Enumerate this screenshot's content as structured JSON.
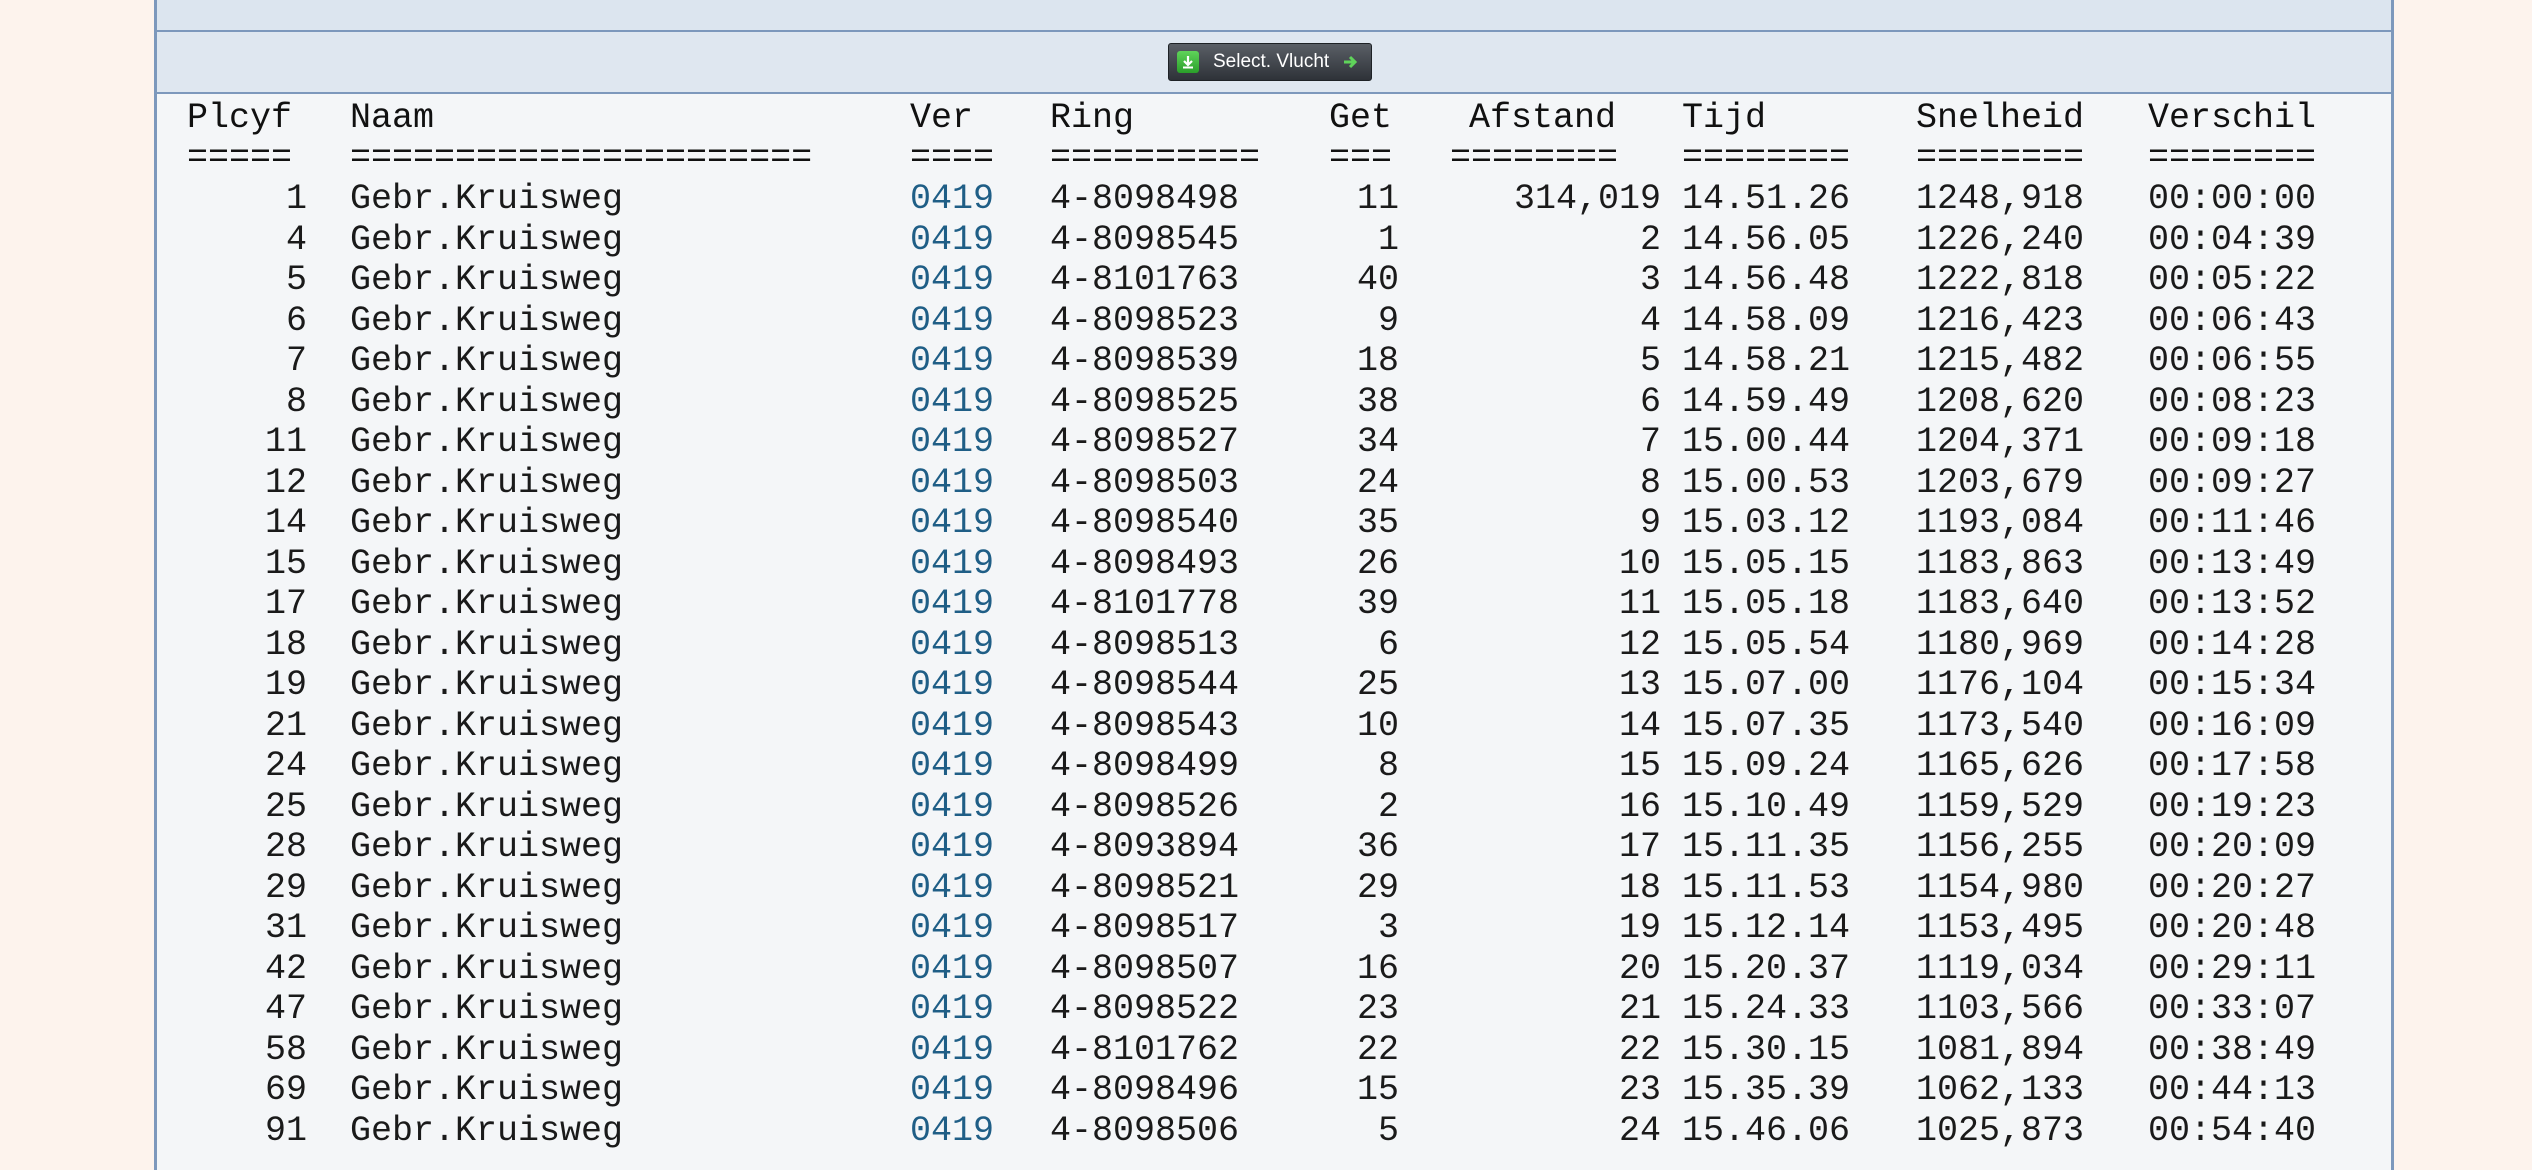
{
  "toolbar": {
    "select_label": "Select. Vlucht"
  },
  "columns": {
    "plcyf": "Plcyf",
    "naam": "Naam",
    "ver": "Ver",
    "ring": "Ring",
    "get": "Get",
    "afstand": "Afstand",
    "tijd": "Tijd",
    "snelheid": "Snelheid",
    "verschil": "Verschil"
  },
  "separators": {
    "plcyf": "=====",
    "naam": "======================",
    "ver": "====",
    "ring": "==========",
    "get": "===",
    "afstand": "========",
    "tijd": "========",
    "snelheid": "========",
    "verschil": "========"
  },
  "rows": [
    {
      "plcyf": "1",
      "naam": "Gebr.Kruisweg",
      "ver": "0419",
      "ring": "4-8098498",
      "get": "11",
      "afstand": "314,019",
      "tijd": "14.51.26",
      "snelheid": "1248,918",
      "verschil": "00:00:00"
    },
    {
      "plcyf": "4",
      "naam": "Gebr.Kruisweg",
      "ver": "0419",
      "ring": "4-8098545",
      "get": "1",
      "afstand": "2",
      "tijd": "14.56.05",
      "snelheid": "1226,240",
      "verschil": "00:04:39"
    },
    {
      "plcyf": "5",
      "naam": "Gebr.Kruisweg",
      "ver": "0419",
      "ring": "4-8101763",
      "get": "40",
      "afstand": "3",
      "tijd": "14.56.48",
      "snelheid": "1222,818",
      "verschil": "00:05:22"
    },
    {
      "plcyf": "6",
      "naam": "Gebr.Kruisweg",
      "ver": "0419",
      "ring": "4-8098523",
      "get": "9",
      "afstand": "4",
      "tijd": "14.58.09",
      "snelheid": "1216,423",
      "verschil": "00:06:43"
    },
    {
      "plcyf": "7",
      "naam": "Gebr.Kruisweg",
      "ver": "0419",
      "ring": "4-8098539",
      "get": "18",
      "afstand": "5",
      "tijd": "14.58.21",
      "snelheid": "1215,482",
      "verschil": "00:06:55"
    },
    {
      "plcyf": "8",
      "naam": "Gebr.Kruisweg",
      "ver": "0419",
      "ring": "4-8098525",
      "get": "38",
      "afstand": "6",
      "tijd": "14.59.49",
      "snelheid": "1208,620",
      "verschil": "00:08:23"
    },
    {
      "plcyf": "11",
      "naam": "Gebr.Kruisweg",
      "ver": "0419",
      "ring": "4-8098527",
      "get": "34",
      "afstand": "7",
      "tijd": "15.00.44",
      "snelheid": "1204,371",
      "verschil": "00:09:18"
    },
    {
      "plcyf": "12",
      "naam": "Gebr.Kruisweg",
      "ver": "0419",
      "ring": "4-8098503",
      "get": "24",
      "afstand": "8",
      "tijd": "15.00.53",
      "snelheid": "1203,679",
      "verschil": "00:09:27"
    },
    {
      "plcyf": "14",
      "naam": "Gebr.Kruisweg",
      "ver": "0419",
      "ring": "4-8098540",
      "get": "35",
      "afstand": "9",
      "tijd": "15.03.12",
      "snelheid": "1193,084",
      "verschil": "00:11:46"
    },
    {
      "plcyf": "15",
      "naam": "Gebr.Kruisweg",
      "ver": "0419",
      "ring": "4-8098493",
      "get": "26",
      "afstand": "10",
      "tijd": "15.05.15",
      "snelheid": "1183,863",
      "verschil": "00:13:49"
    },
    {
      "plcyf": "17",
      "naam": "Gebr.Kruisweg",
      "ver": "0419",
      "ring": "4-8101778",
      "get": "39",
      "afstand": "11",
      "tijd": "15.05.18",
      "snelheid": "1183,640",
      "verschil": "00:13:52"
    },
    {
      "plcyf": "18",
      "naam": "Gebr.Kruisweg",
      "ver": "0419",
      "ring": "4-8098513",
      "get": "6",
      "afstand": "12",
      "tijd": "15.05.54",
      "snelheid": "1180,969",
      "verschil": "00:14:28"
    },
    {
      "plcyf": "19",
      "naam": "Gebr.Kruisweg",
      "ver": "0419",
      "ring": "4-8098544",
      "get": "25",
      "afstand": "13",
      "tijd": "15.07.00",
      "snelheid": "1176,104",
      "verschil": "00:15:34"
    },
    {
      "plcyf": "21",
      "naam": "Gebr.Kruisweg",
      "ver": "0419",
      "ring": "4-8098543",
      "get": "10",
      "afstand": "14",
      "tijd": "15.07.35",
      "snelheid": "1173,540",
      "verschil": "00:16:09"
    },
    {
      "plcyf": "24",
      "naam": "Gebr.Kruisweg",
      "ver": "0419",
      "ring": "4-8098499",
      "get": "8",
      "afstand": "15",
      "tijd": "15.09.24",
      "snelheid": "1165,626",
      "verschil": "00:17:58"
    },
    {
      "plcyf": "25",
      "naam": "Gebr.Kruisweg",
      "ver": "0419",
      "ring": "4-8098526",
      "get": "2",
      "afstand": "16",
      "tijd": "15.10.49",
      "snelheid": "1159,529",
      "verschil": "00:19:23"
    },
    {
      "plcyf": "28",
      "naam": "Gebr.Kruisweg",
      "ver": "0419",
      "ring": "4-8093894",
      "get": "36",
      "afstand": "17",
      "tijd": "15.11.35",
      "snelheid": "1156,255",
      "verschil": "00:20:09"
    },
    {
      "plcyf": "29",
      "naam": "Gebr.Kruisweg",
      "ver": "0419",
      "ring": "4-8098521",
      "get": "29",
      "afstand": "18",
      "tijd": "15.11.53",
      "snelheid": "1154,980",
      "verschil": "00:20:27"
    },
    {
      "plcyf": "31",
      "naam": "Gebr.Kruisweg",
      "ver": "0419",
      "ring": "4-8098517",
      "get": "3",
      "afstand": "19",
      "tijd": "15.12.14",
      "snelheid": "1153,495",
      "verschil": "00:20:48"
    },
    {
      "plcyf": "42",
      "naam": "Gebr.Kruisweg",
      "ver": "0419",
      "ring": "4-8098507",
      "get": "16",
      "afstand": "20",
      "tijd": "15.20.37",
      "snelheid": "1119,034",
      "verschil": "00:29:11"
    },
    {
      "plcyf": "47",
      "naam": "Gebr.Kruisweg",
      "ver": "0419",
      "ring": "4-8098522",
      "get": "23",
      "afstand": "21",
      "tijd": "15.24.33",
      "snelheid": "1103,566",
      "verschil": "00:33:07"
    },
    {
      "plcyf": "58",
      "naam": "Gebr.Kruisweg",
      "ver": "0419",
      "ring": "4-8101762",
      "get": "22",
      "afstand": "22",
      "tijd": "15.30.15",
      "snelheid": "1081,894",
      "verschil": "00:38:49"
    },
    {
      "plcyf": "69",
      "naam": "Gebr.Kruisweg",
      "ver": "0419",
      "ring": "4-8098496",
      "get": "15",
      "afstand": "23",
      "tijd": "15.35.39",
      "snelheid": "1062,133",
      "verschil": "00:44:13"
    },
    {
      "plcyf": "91",
      "naam": "Gebr.Kruisweg",
      "ver": "0419",
      "ring": "4-8098506",
      "get": "5",
      "afstand": "24",
      "tijd": "15.46.06",
      "snelheid": "1025,873",
      "verschil": "00:54:40"
    }
  ]
}
